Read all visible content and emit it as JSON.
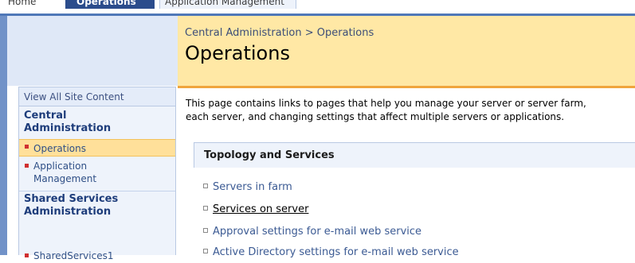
{
  "tabs": [
    {
      "label": "Home"
    },
    {
      "label": "Operations"
    },
    {
      "label": "Application Management"
    }
  ],
  "breadcrumb": {
    "root": "Central Administration",
    "separator": ">",
    "current": "Operations"
  },
  "page_title": "Operations",
  "left_nav": {
    "view_all": "View All Site Content",
    "sections": [
      {
        "heading_line1": "Central",
        "heading_line2": "Administration",
        "items": [
          {
            "label": "Operations",
            "selected": true
          },
          {
            "label_line1": "Application",
            "label_line2": "Management",
            "selected": false
          }
        ]
      },
      {
        "heading_line1": "Shared Services",
        "heading_line2": "Administration",
        "items": [
          {
            "label": "SharedServices1"
          }
        ]
      }
    ]
  },
  "main": {
    "intro_line1": "This page contains links to pages that help you manage your server or server farm,",
    "intro_line2": "each server, and changing settings that affect multiple servers or applications.",
    "section_title": "Topology and Services",
    "links": [
      {
        "label": "Servers in farm"
      },
      {
        "label": "Services on server"
      },
      {
        "label": "Approval settings for e-mail web service"
      },
      {
        "label": "Active Directory settings for e-mail web service"
      }
    ]
  },
  "colors": {
    "accent_blue": "#2b4c8c",
    "title_band": "#ffe8a5",
    "rule_orange": "#f0a53d",
    "selected_nav": "#ffe09a",
    "bullet_red": "#d03030"
  }
}
